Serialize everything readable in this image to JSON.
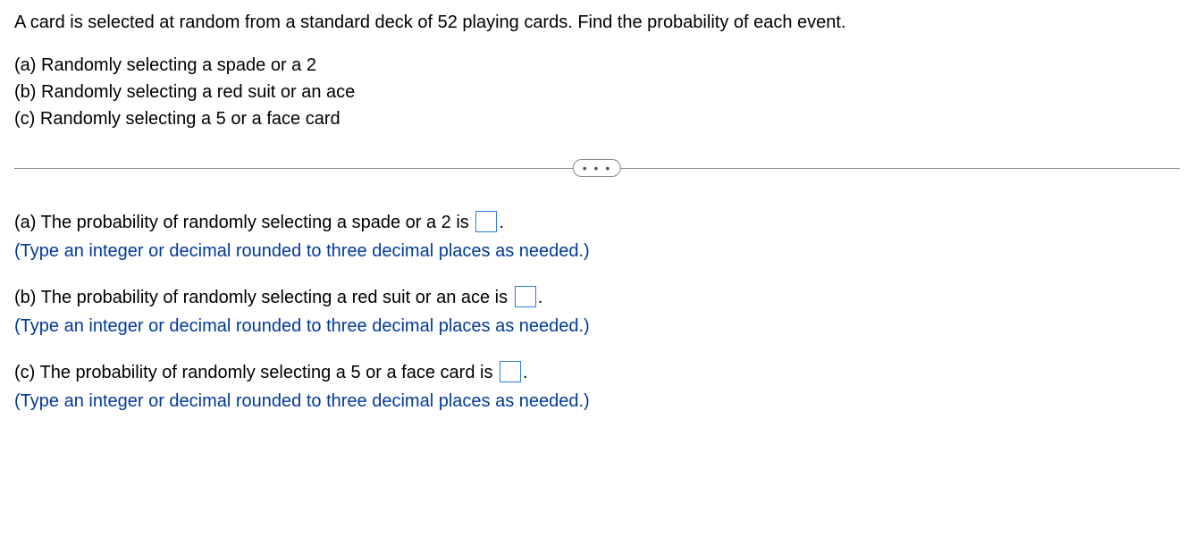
{
  "intro": "A card is selected at random from a standard deck of 52 playing cards. Find the probability of each event.",
  "parts": {
    "a": "(a) Randomly selecting a spade or a 2",
    "b": "(b) Randomly selecting a red suit or an ace",
    "c": "(c) Randomly selecting a 5 or a face card"
  },
  "divider_dots": "• • •",
  "answers": {
    "a": {
      "prefix": "(a) The probability of randomly selecting a spade or a 2 is ",
      "suffix": ".",
      "hint": "(Type an integer or decimal rounded to three decimal places as needed.)"
    },
    "b": {
      "prefix": "(b) The probability of randomly selecting a red suit or an ace is ",
      "suffix": ".",
      "hint": "(Type an integer or decimal rounded to three decimal places as needed.)"
    },
    "c": {
      "prefix": "(c) The probability of randomly selecting a 5 or a face card is ",
      "suffix": ".",
      "hint": "(Type an integer or decimal rounded to three decimal places as needed.)"
    }
  }
}
